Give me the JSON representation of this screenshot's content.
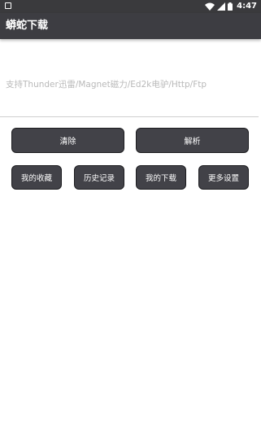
{
  "status_bar": {
    "time": "4:47",
    "icons": [
      "notification-square-icon",
      "wifi-icon",
      "signal-icon",
      "battery-icon"
    ]
  },
  "app_bar": {
    "title": "蟒蛇下载"
  },
  "link_input": {
    "value": "",
    "placeholder": "支持Thunder迅雷/Magnet磁力/Ed2k电驴/Http/Ftp"
  },
  "actions": {
    "clear_label": "清除",
    "parse_label": "解析"
  },
  "shortcuts": {
    "favorites_label": "我的收藏",
    "history_label": "历史记录",
    "downloads_label": "我的下载",
    "settings_label": "更多设置"
  },
  "colors": {
    "bar_background": "#3d3d42",
    "button_background": "#424248",
    "button_border": "#1c1c1f",
    "placeholder": "#b9b9b9"
  }
}
